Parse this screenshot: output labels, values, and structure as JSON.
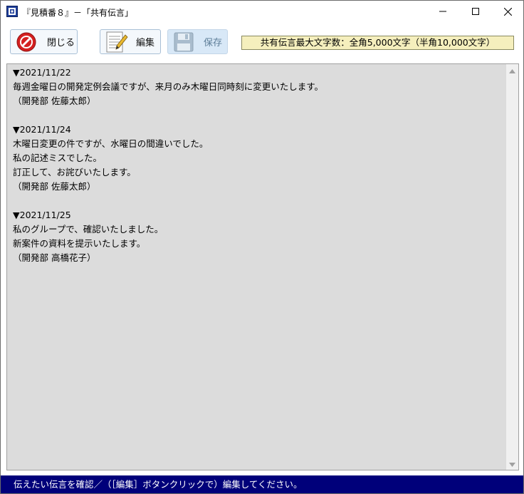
{
  "window": {
    "title": "『見積番８』－「共有伝言」",
    "app_icon": "app-window-icon",
    "controls": {
      "minimize_icon": "minimize-icon",
      "maximize_icon": "maximize-icon",
      "close_icon": "close-icon"
    }
  },
  "toolbar": {
    "close_label": "閉じる",
    "close_icon": "no-entry-icon",
    "edit_label": "編集",
    "edit_icon": "document-pencil-icon",
    "save_label": "保存",
    "save_icon": "floppy-disk-icon",
    "limit_text": "共有伝言最大文字数：全角5,000文字（半角10,000文字）"
  },
  "memo": {
    "lines": [
      "▼2021/11/22",
      "毎週金曜日の開発定例会議ですが、来月のみ木曜日同時刻に変更いたします。",
      "（開発部 佐藤太郎）",
      "",
      "▼2021/11/24",
      "木曜日変更の件ですが、水曜日の間違いでした。",
      "私の記述ミスでした。",
      "訂正して、お詫びいたします。",
      "（開発部 佐藤太郎）",
      "",
      "▼2021/11/25",
      "私のグループで、確認いたしました。",
      "新案件の資料を提示いたします。",
      "（開発部 高橋花子）"
    ]
  },
  "status": {
    "text": "伝えたい伝言を確認／（［編集］ボタンクリックで）編集してください。"
  },
  "colors": {
    "statusbar_bg": "#00007a",
    "memo_bg": "#dcdcdc",
    "limit_label_bg": "#f5efbd",
    "close_icon_red": "#d42020"
  }
}
